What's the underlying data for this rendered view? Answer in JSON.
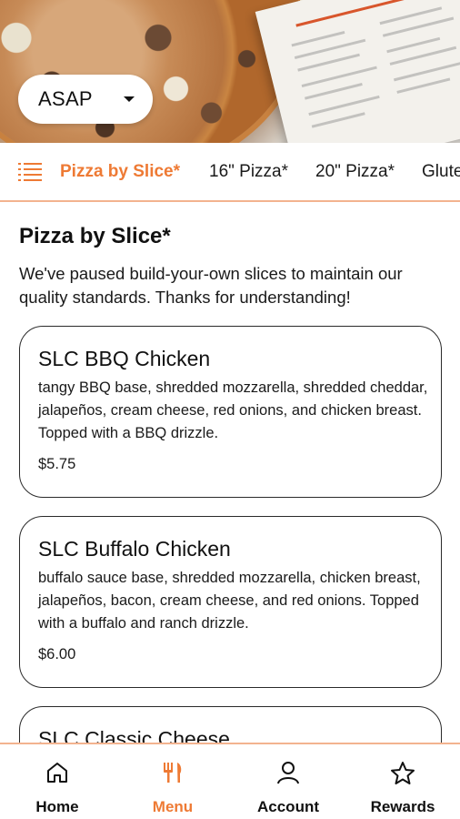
{
  "order_time": {
    "value": "ASAP"
  },
  "categories": [
    {
      "label": "Pizza by Slice*",
      "active": true
    },
    {
      "label": "16\" Pizza*",
      "active": false
    },
    {
      "label": "20\" Pizza*",
      "active": false
    },
    {
      "label": "Gluten",
      "active": false
    }
  ],
  "section": {
    "title": "Pizza by Slice*",
    "notice": "We've paused build-your-own slices to maintain our quality standards. Thanks for understanding!"
  },
  "items": [
    {
      "name": "SLC BBQ Chicken",
      "description": "tangy BBQ base, shredded mozzarella, shredded cheddar, jalapeños, cream cheese, red onions, and chicken breast. Topped with a BBQ drizzle.",
      "price": "$5.75"
    },
    {
      "name": "SLC Buffalo Chicken",
      "description": "buffalo sauce base, shredded mozzarella, chicken breast, jalapeños, bacon, cream cheese, and red onions. Topped with a buffalo and ranch drizzle.",
      "price": "$6.00"
    },
    {
      "name": "SLC Classic Cheese",
      "description": "",
      "price": ""
    }
  ],
  "bottom_nav": [
    {
      "label": "Home",
      "icon": "home-icon",
      "active": false
    },
    {
      "label": "Menu",
      "icon": "fork-knife-icon",
      "active": true
    },
    {
      "label": "Account",
      "icon": "person-icon",
      "active": false
    },
    {
      "label": "Rewards",
      "icon": "star-icon",
      "active": false
    }
  ],
  "colors": {
    "accent": "#ee7a34",
    "divider": "#f3b38f",
    "text": "#111111"
  }
}
